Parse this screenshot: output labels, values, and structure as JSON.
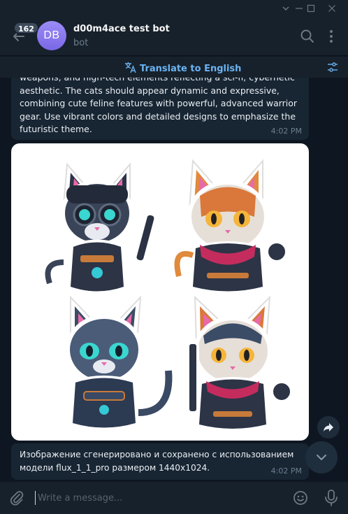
{
  "window": {
    "controls": [
      "chevron-down-icon",
      "minimize-icon",
      "maximize-icon",
      "close-icon"
    ]
  },
  "header": {
    "unread_count": "162",
    "avatar_initials": "DB",
    "chat_name": "d00m4ace test bot",
    "chat_status": "bot",
    "icons": [
      "back-arrow-icon",
      "search-icon",
      "more-vertical-icon"
    ]
  },
  "translate": {
    "label": "Translate to English",
    "icons": [
      "translate-icon",
      "filter-settings-icon"
    ]
  },
  "messages": [
    {
      "text": "weapons, and high-tech elements reflecting a sci-fi, cybernetic aesthetic. The cats should appear dynamic and expressive, combining cute feline features with powerful, advanced warrior gear. Use vibrant colors and detailed designs to emphasize the futuristic theme.",
      "time": "4:02 PM"
    },
    {
      "type": "image",
      "description_icons": [
        "cyber-cat-sticker-1",
        "cyber-cat-sticker-2",
        "cyber-cat-sticker-3",
        "cyber-cat-sticker-4"
      ]
    },
    {
      "text": "Изображение сгенерировано и сохранено с использованием модели flux_1_1_pro размером 1440x1024.",
      "time": "4:02 PM"
    }
  ],
  "composer": {
    "placeholder": "Write a message...",
    "icons": [
      "attach-icon",
      "emoji-icon",
      "microphone-icon"
    ]
  },
  "floating": [
    "share-icon",
    "scroll-down-icon"
  ],
  "colors": {
    "background": "#0e1621",
    "panel": "#17212b",
    "bubble": "#182533",
    "accent": "#6ab3f3",
    "avatar": "#8a7cf0"
  }
}
